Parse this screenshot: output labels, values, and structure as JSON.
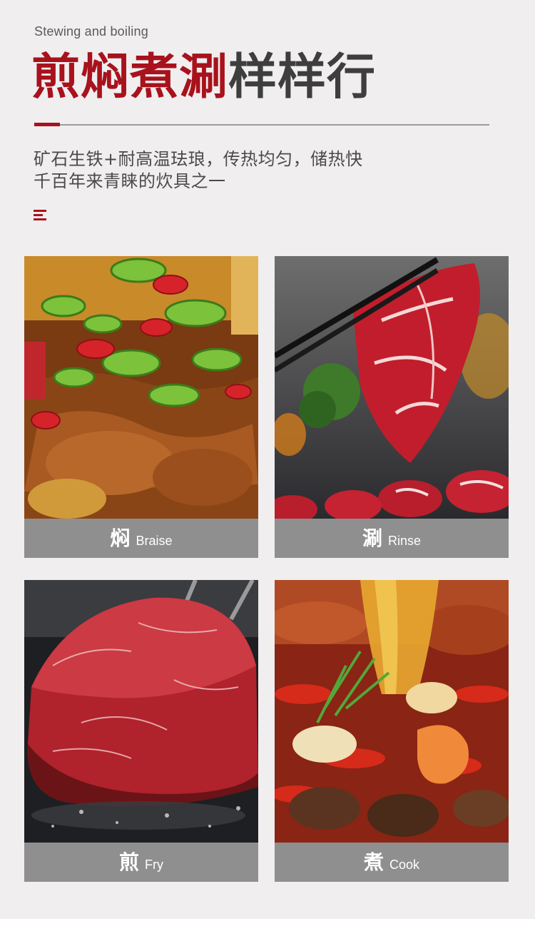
{
  "header": {
    "subtitle": "Stewing and boiling",
    "title_accent": "煎焖煮涮",
    "title_plain": "样样行"
  },
  "description": {
    "line1": "矿石生铁+耐高温珐琅，传热均匀，储热快",
    "line2": "千百年来青睐的炊具之一"
  },
  "cards": [
    {
      "zh": "焖",
      "en": "Braise",
      "photo": "braised-chicken-with-peppers"
    },
    {
      "zh": "涮",
      "en": "Rinse",
      "photo": "sliced-beef-with-chopsticks"
    },
    {
      "zh": "煎",
      "en": "Fry",
      "photo": "seared-steak-in-pan"
    },
    {
      "zh": "煮",
      "en": "Cook",
      "photo": "spicy-hotpot-with-oil"
    }
  ],
  "colors": {
    "accent": "#a8121c",
    "caption_bar": "#8f8f8f",
    "background": "#f0eeef"
  }
}
